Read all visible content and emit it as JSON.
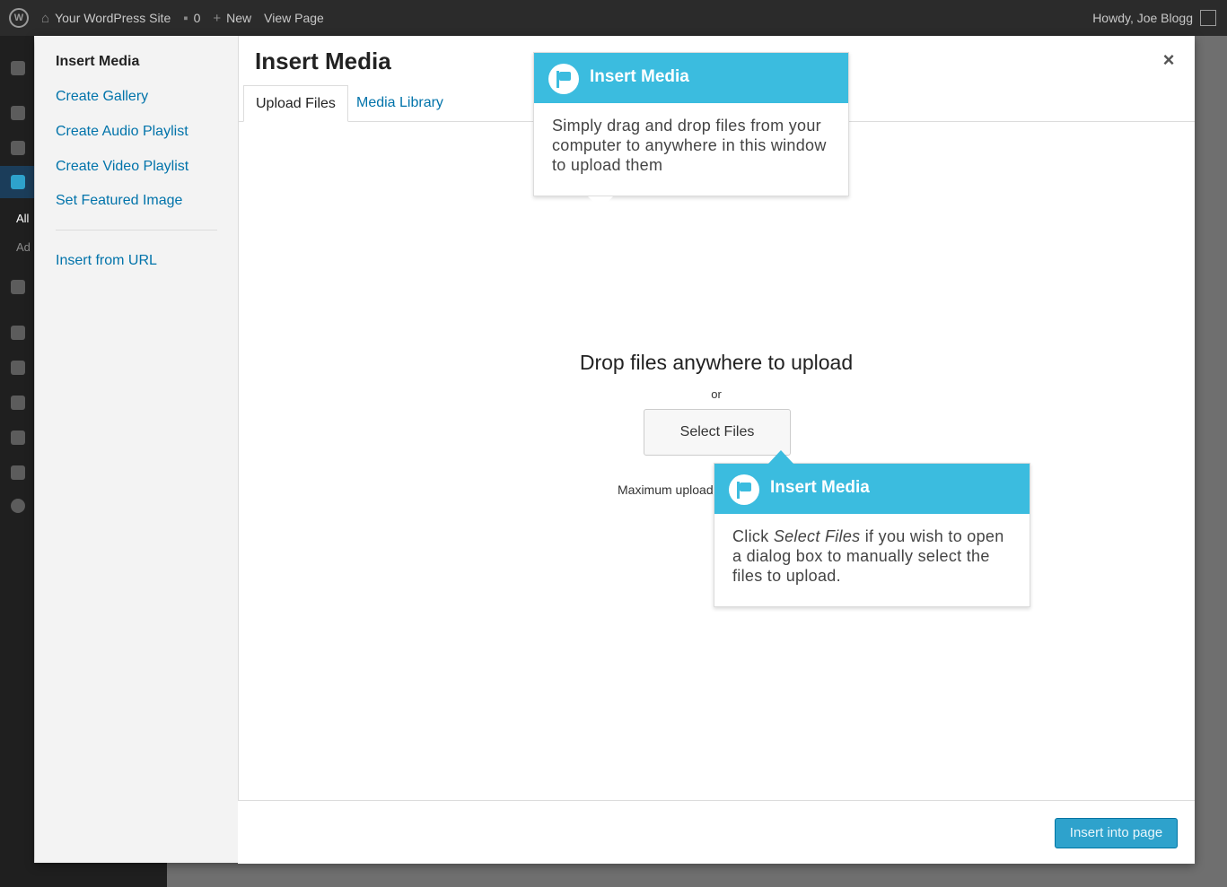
{
  "admin_bar": {
    "site_name": "Your WordPress Site",
    "comments_count": "0",
    "new_label": "New",
    "view_page_label": "View Page",
    "greeting": "Howdy, Joe Blogg"
  },
  "admin_menu": {
    "sub_all": "All",
    "sub_add": "Ad"
  },
  "media_menu": {
    "title": "Insert Media",
    "items": [
      {
        "label": "Create Gallery"
      },
      {
        "label": "Create Audio Playlist"
      },
      {
        "label": "Create Video Playlist"
      },
      {
        "label": "Set Featured Image"
      },
      {
        "label": "Insert from URL"
      }
    ]
  },
  "frame": {
    "title": "Insert Media",
    "close_label": "×",
    "tabs": [
      {
        "label": "Upload Files",
        "active": true
      },
      {
        "label": "Media Library",
        "active": false
      }
    ]
  },
  "uploader": {
    "drop_title": "Drop files anywhere to upload",
    "or_label": "or",
    "select_files_label": "Select Files",
    "max_upload_label": "Maximum upload"
  },
  "toolbar": {
    "insert_label": "Insert into page"
  },
  "pointers": [
    {
      "title": "Insert Media",
      "body": "Simply drag and drop files from your computer to anywhere in this window to upload them"
    },
    {
      "title": "Insert Media",
      "body_prefix": "Click ",
      "body_emphasis": "Select Files",
      "body_suffix": " if you wish to open a dialog box to manually select the files to upload."
    }
  ],
  "colors": {
    "accent": "#3bbcdf",
    "link": "#0073aa",
    "primary_button": "#2ea2cc"
  }
}
